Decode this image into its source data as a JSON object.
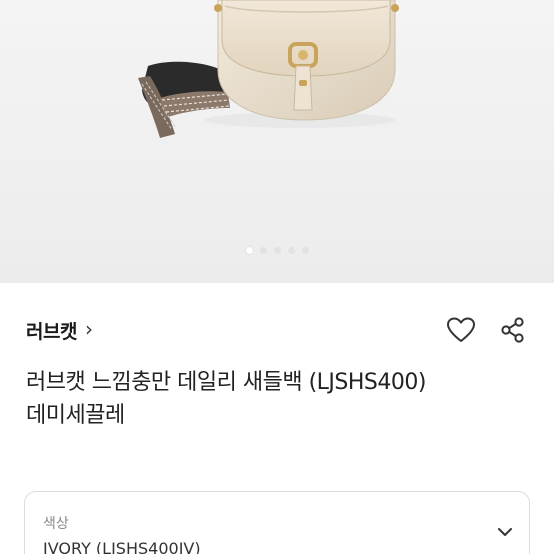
{
  "brand": {
    "name": "러브캣",
    "chevron": "›"
  },
  "product": {
    "title": "러브캣 느낌충만 데일리 새들백 (LJSHS400) 데미세끌레"
  },
  "carousel": {
    "total_slides": 5,
    "active_index": 0
  },
  "option": {
    "label": "색상",
    "value": "IVORY (LJSHS400IV)"
  },
  "icons": {
    "favorite": "heart-outline-icon",
    "share": "share-icon",
    "dropdown": "chevron-down-icon",
    "brand_link": "chevron-right-icon"
  },
  "colors": {
    "hero_background": "#efefef",
    "bag_body": "#e9ddca",
    "hardware": "#c9a35a"
  }
}
